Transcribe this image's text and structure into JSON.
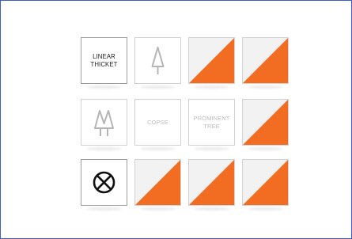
{
  "colors": {
    "orange": "#f26d21",
    "flag_white": "#f2f2f2",
    "frame_border": "#3f5fc8"
  },
  "cards": [
    {
      "kind": "text",
      "label": "LINEAR\nTHICKET",
      "state": "active"
    },
    {
      "kind": "icon",
      "icon": "single-tree-icon",
      "state": "faded"
    },
    {
      "kind": "flag",
      "icon": "control-flag-icon",
      "state": "hidden"
    },
    {
      "kind": "flag",
      "icon": "control-flag-icon",
      "state": "hidden"
    },
    {
      "kind": "icon",
      "icon": "tree-cluster-icon",
      "state": "faded"
    },
    {
      "kind": "text",
      "label": "COPSE",
      "state": "faded"
    },
    {
      "kind": "text",
      "label": "PROMINENT\nTREE",
      "state": "faded"
    },
    {
      "kind": "flag",
      "icon": "control-flag-icon",
      "state": "hidden"
    },
    {
      "kind": "icon",
      "icon": "circle-x-icon",
      "state": "active"
    },
    {
      "kind": "flag",
      "icon": "control-flag-icon",
      "state": "hidden"
    },
    {
      "kind": "flag",
      "icon": "control-flag-icon",
      "state": "hidden"
    },
    {
      "kind": "flag",
      "icon": "control-flag-icon",
      "state": "hidden"
    }
  ]
}
